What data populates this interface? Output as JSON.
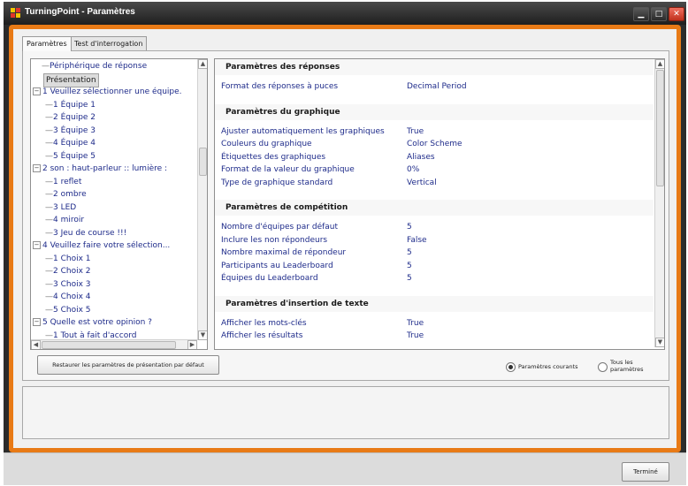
{
  "window": {
    "title": "TurningPoint - Paramètres"
  },
  "tabs": [
    {
      "label": "Paramètres"
    },
    {
      "label": "Test d'interrogation"
    }
  ],
  "tree": {
    "items": [
      {
        "prefix": "—",
        "label": "Périphérique de réponse",
        "expander": ""
      },
      {
        "prefix": "",
        "label": "Présentation",
        "expander": ""
      },
      {
        "prefix": "",
        "label": "1  Veuillez sélectionner une équipe.",
        "expander": "−"
      },
      {
        "prefix": "—",
        "label": "1  Équipe 1",
        "expander": ""
      },
      {
        "prefix": "—",
        "label": "2  Équipe 2",
        "expander": ""
      },
      {
        "prefix": "—",
        "label": "3  Équipe 3",
        "expander": ""
      },
      {
        "prefix": "—",
        "label": "4  Équipe 4",
        "expander": ""
      },
      {
        "prefix": "—",
        "label": "5  Équipe 5",
        "expander": ""
      },
      {
        "prefix": "",
        "label": "2  son : haut-parleur :: lumière :",
        "expander": "−"
      },
      {
        "prefix": "—",
        "label": "1  reflet",
        "expander": ""
      },
      {
        "prefix": "—",
        "label": "2  ombre",
        "expander": ""
      },
      {
        "prefix": "—",
        "label": "3  LED",
        "expander": ""
      },
      {
        "prefix": "—",
        "label": "4  miroir",
        "expander": ""
      },
      {
        "prefix": "—",
        "label": "3  Jeu de course !!!",
        "expander": ""
      },
      {
        "prefix": "",
        "label": "4  Veuillez faire votre sélection...",
        "expander": "−"
      },
      {
        "prefix": "—",
        "label": "1  Choix 1",
        "expander": ""
      },
      {
        "prefix": "—",
        "label": "2  Choix 2",
        "expander": ""
      },
      {
        "prefix": "—",
        "label": "3  Choix 3",
        "expander": ""
      },
      {
        "prefix": "—",
        "label": "4  Choix 4",
        "expander": ""
      },
      {
        "prefix": "—",
        "label": "5  Choix 5",
        "expander": ""
      },
      {
        "prefix": "",
        "label": "5  Quelle est votre opinion ?",
        "expander": "−"
      },
      {
        "prefix": "—",
        "label": "1  Tout à fait d'accord",
        "expander": ""
      }
    ]
  },
  "properties": {
    "sections": [
      {
        "title": "Paramètres des réponses",
        "rows": [
          {
            "name": "Format des réponses à puces",
            "value": "Decimal Period"
          }
        ]
      },
      {
        "title": "Paramètres du graphique",
        "rows": [
          {
            "name": "Ajuster automatiquement les graphiques",
            "value": "True"
          },
          {
            "name": "Couleurs du graphique",
            "value": "Color Scheme"
          },
          {
            "name": "Étiquettes des graphiques",
            "value": "Aliases"
          },
          {
            "name": "Format de la valeur du graphique",
            "value": "0%"
          },
          {
            "name": "Type de graphique standard",
            "value": "Vertical"
          }
        ]
      },
      {
        "title": "Paramètres de compétition",
        "rows": [
          {
            "name": "Nombre d'équipes par défaut",
            "value": "5"
          },
          {
            "name": "Inclure les non répondeurs",
            "value": "False"
          },
          {
            "name": "Nombre maximal de répondeur",
            "value": "5"
          },
          {
            "name": "Participants au Leaderboard",
            "value": "5"
          },
          {
            "name": "Équipes du Leaderboard",
            "value": "5"
          }
        ]
      },
      {
        "title": "Paramètres d'insertion de texte",
        "rows": [
          {
            "name": "Afficher les mots-clés",
            "value": "True"
          },
          {
            "name": "Afficher les résultats",
            "value": "True"
          }
        ]
      }
    ]
  },
  "restore_button": "Restaurer les paramètres de présentation par défaut",
  "radio": {
    "current": {
      "label": "Paramètres courants",
      "selected": true
    },
    "all": {
      "label_line1": "Tous les",
      "label_line2": "paramètres",
      "selected": false
    }
  },
  "footer": {
    "done_label": "Terminé"
  },
  "colors": {
    "accent_orange": "#e87a16",
    "link_blue": "#1e2b8a",
    "close_red": "#c0301c"
  },
  "icons": {
    "app": "turningpoint-logo-icon",
    "minimize": "minimize-icon",
    "maximize": "maximize-icon",
    "close": "close-icon"
  }
}
